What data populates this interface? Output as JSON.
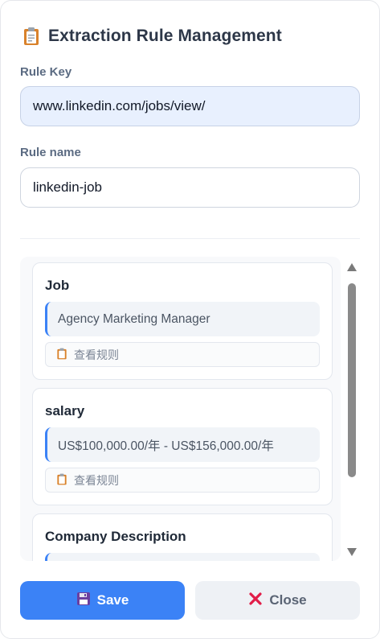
{
  "header": {
    "title": "Extraction Rule Management",
    "icon": "clipboard-icon"
  },
  "form": {
    "rule_key": {
      "label": "Rule Key",
      "value": "www.linkedin.com/jobs/view/"
    },
    "rule_name": {
      "label": "Rule name",
      "value": "linkedin-job"
    }
  },
  "fields": [
    {
      "name": "Job",
      "value": "Agency Marketing Manager",
      "rule_label": "查看规则"
    },
    {
      "name": "salary",
      "value": "US$100,000.00/年 - US$156,000.00/年",
      "rule_label": "查看规则"
    },
    {
      "name": "Company Description",
      "value": "",
      "rule_label": ""
    }
  ],
  "actions": {
    "save_label": "Save",
    "close_label": "Close"
  },
  "colors": {
    "accent": "#3b82f6",
    "readonly_bg": "#e8f0fe",
    "close_x": "#e11d48"
  }
}
